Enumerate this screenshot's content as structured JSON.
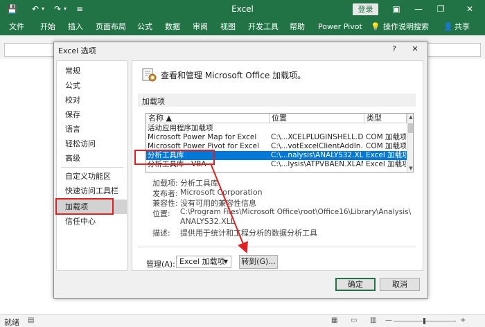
{
  "window": {
    "title": "Excel",
    "login_label": "登录",
    "share_label": "共享"
  },
  "ribbon": {
    "tabs": [
      "文件",
      "开始",
      "插入",
      "页面布局",
      "公式",
      "数据",
      "审阅",
      "视图",
      "开发工具",
      "帮助",
      "Power Pivot"
    ],
    "search_label": "操作说明搜索"
  },
  "status": {
    "ready": "就绪"
  },
  "dialog": {
    "title": "Excel 选项",
    "help": "?",
    "close": "✕",
    "nav": [
      "常规",
      "公式",
      "校对",
      "保存",
      "语言",
      "轻松访问",
      "高级",
      "自定义功能区",
      "快速访问工具栏",
      "加载项",
      "信任中心"
    ],
    "active_nav": "加载项",
    "header": "查看和管理 Microsoft Office 加载项。",
    "section": "加载项",
    "columns": {
      "name": "名称 ▲",
      "location": "位置",
      "type": "类型"
    },
    "group_active": "活动应用程序加载项",
    "rows": [
      {
        "name": "Microsoft Power Map for Excel",
        "location": "C:\\...XCELPLUGINSHELL.DLL",
        "type": "COM 加载项"
      },
      {
        "name": "Microsoft Power Pivot for Excel",
        "location": "C:\\...votExcelClientAddIn.dll",
        "type": "COM 加载项"
      },
      {
        "name": "分析工具库",
        "location": "C:\\...nalysis\\ANALYS32.XLL",
        "type": "Excel 加载项"
      },
      {
        "name": "分析工具库 - VBA",
        "location": "C:\\...lysis\\ATPVBAEN.XLAM",
        "type": "Excel 加载项"
      }
    ],
    "details": {
      "addin_label": "加载项:",
      "addin_value": "分析工具库",
      "publisher_label": "发布者:",
      "publisher_value": "Microsoft Corporation",
      "compat_label": "兼容性:",
      "compat_value": "没有可用的兼容性信息",
      "location_label": "位置:",
      "location_value_1": "C:\\Program Files\\Microsoft Office\\root\\Office16\\Library\\Analysis\\",
      "location_value_2": "ANALYS32.XLL",
      "desc_label": "描述:",
      "desc_value": "提供用于统计和工程分析的数据分析工具"
    },
    "manage_label": "管理(A):",
    "manage_value": "Excel 加载项",
    "goto_label": "转到(G)...",
    "ok_label": "确定",
    "cancel_label": "取消"
  },
  "colors": {
    "excel_green": "#217346",
    "selection_blue": "#0078d7",
    "annotation_red": "#e02020"
  }
}
